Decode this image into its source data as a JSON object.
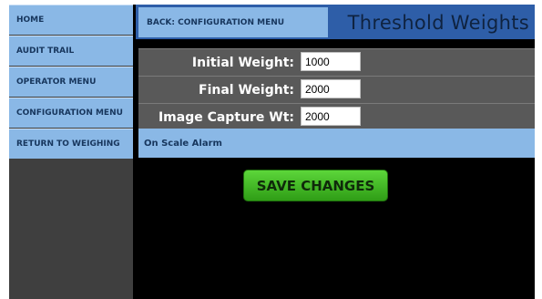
{
  "sidebar": {
    "items": [
      {
        "label": "HOME"
      },
      {
        "label": "AUDIT TRAIL"
      },
      {
        "label": "OPERATOR MENU"
      },
      {
        "label": "CONFIGURATION MENU"
      },
      {
        "label": "RETURN TO WEIGHING"
      }
    ]
  },
  "header": {
    "back_label": "BACK: CONFIGURATION MENU",
    "title": "Threshold Weights"
  },
  "form": {
    "rows": [
      {
        "label": "Initial Weight:",
        "value": "1000"
      },
      {
        "label": "Final Weight:",
        "value": "2000"
      },
      {
        "label": "Image Capture Wt:",
        "value": "2000"
      }
    ],
    "alarm_label": "On Scale Alarm",
    "save_label": "SAVE CHANGES"
  },
  "colors": {
    "nav_button": "#8ab8e6",
    "header_bar": "#2e5ea8",
    "row_bg": "#595959",
    "save_button": "#3fb51f",
    "background": "#000000"
  }
}
